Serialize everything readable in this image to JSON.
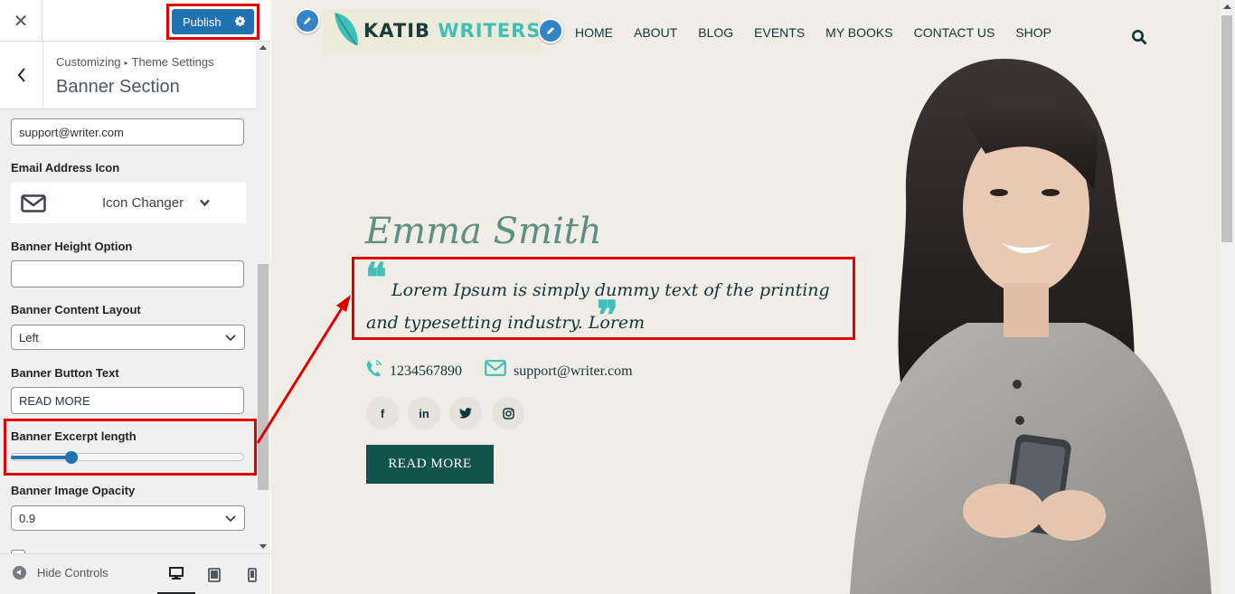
{
  "customizer": {
    "close_icon": "close-icon",
    "publish_label": "Publish",
    "breadcrumb_root": "Customizing",
    "breadcrumb_sep": "▸",
    "breadcrumb_parent": "Theme Settings",
    "section_title": "Banner Section",
    "controls": {
      "email_value": "support@writer.com",
      "email_icon_label": "Email Address Icon",
      "icon_changer_label": "Icon Changer",
      "banner_height_label": "Banner Height Option",
      "banner_height_value": "",
      "content_layout_label": "Banner Content Layout",
      "content_layout_value": "Left",
      "button_text_label": "Banner Button Text",
      "button_text_value": "READ MORE",
      "excerpt_length_label": "Banner Excerpt length",
      "excerpt_length_fraction": 0.26,
      "image_opacity_label": "Banner Image Opacity",
      "image_opacity_value": "0.9"
    },
    "footer": {
      "hide_controls_label": "Hide Controls",
      "devices": [
        "desktop",
        "tablet",
        "mobile"
      ],
      "active_device": "desktop"
    }
  },
  "site": {
    "logo_main": "KATIB",
    "logo_accent": "WRITERS",
    "nav": [
      "HOME",
      "ABOUT",
      "BLOG",
      "EVENTS",
      "MY BOOKS",
      "CONTACT US",
      "SHOP"
    ],
    "hero": {
      "name": "Emma Smith",
      "quote_open": "❝",
      "excerpt": "Lorem Ipsum is simply dummy text of the printing and typesetting industry. Lorem",
      "quote_close": "❞",
      "phone": "1234567890",
      "email": "support@writer.com",
      "socials": [
        "f",
        "in",
        "twitter",
        "instagram"
      ],
      "button": "READ MORE"
    }
  },
  "colors": {
    "wp_blue": "#2271b1",
    "highlight_red": "#e00000",
    "brand_dark": "#12343b",
    "brand_teal": "#3fbfb7",
    "button_green": "#12534b"
  }
}
